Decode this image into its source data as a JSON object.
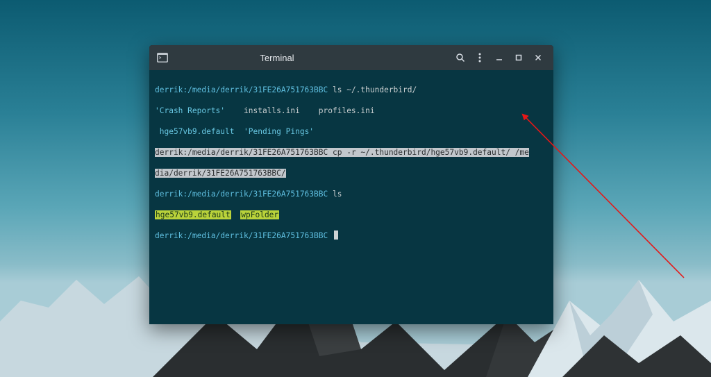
{
  "window": {
    "title": "Terminal"
  },
  "prompt": {
    "user": "derrik",
    "path": "/media/derrik/31FE26A751763BBC"
  },
  "lines": {
    "l1_cmd": "ls ~/.thunderbird/",
    "l2_a": "'Crash Reports'",
    "l2_b": "installs.ini",
    "l2_c": "profiles.ini",
    "l3_a": "hge57vb9.default",
    "l3_b": "'Pending Pings'",
    "l4_cmd_part1": "cp -r ~/.thunderbird/hge57vb9.default/ /me",
    "l5_cmd_part2": "dia/derrik/31FE26A751763BBC/",
    "l6_cmd": "ls",
    "l7_a": "hge57vb9.default",
    "l7_b": "wpFolder"
  }
}
